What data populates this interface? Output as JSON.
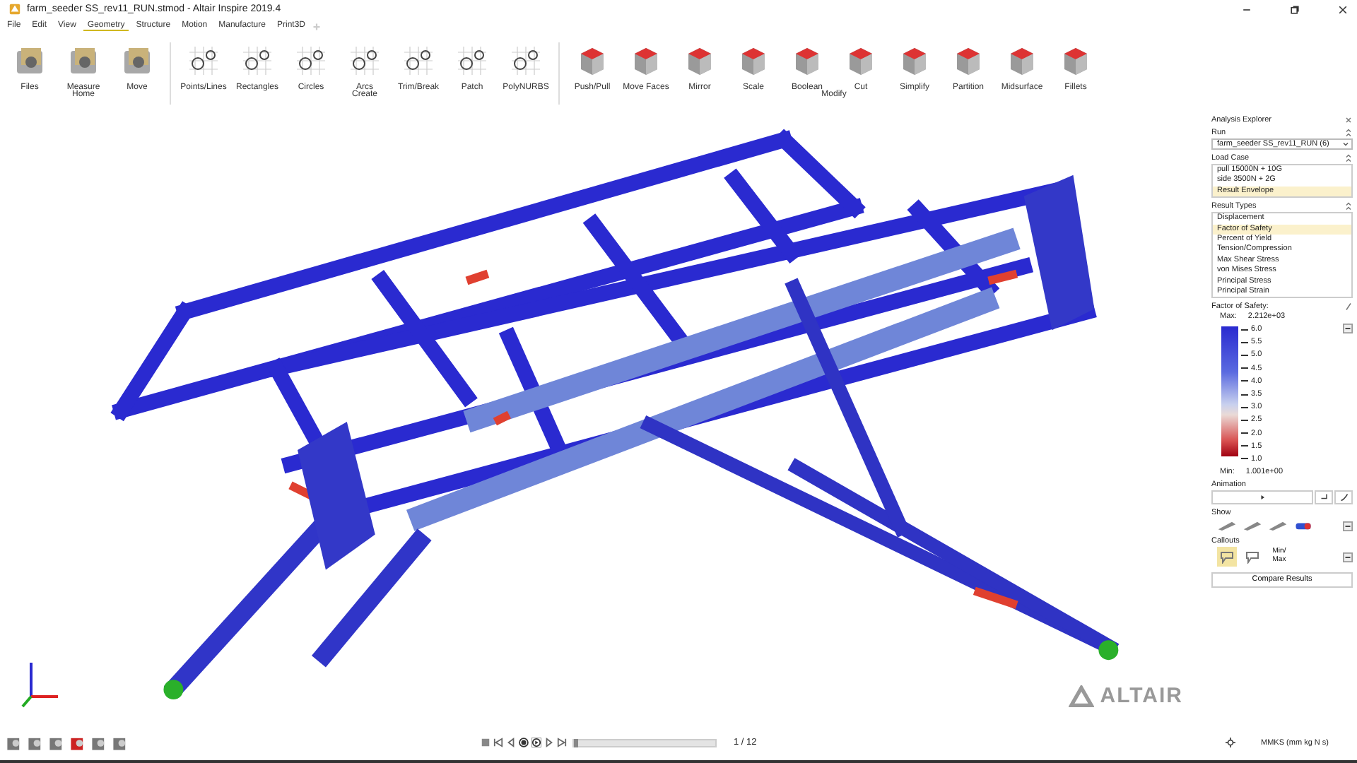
{
  "window": {
    "title": "farm_seeder SS_rev11_RUN.stmod - Altair Inspire 2019.4"
  },
  "menu": [
    {
      "label": "File",
      "selected": false
    },
    {
      "label": "Edit",
      "selected": false
    },
    {
      "label": "View",
      "selected": false
    },
    {
      "label": "Geometry",
      "selected": true
    },
    {
      "label": "Structure",
      "selected": false
    },
    {
      "label": "Motion",
      "selected": false
    },
    {
      "label": "Manufacture",
      "selected": false
    },
    {
      "label": "Print3D",
      "selected": false
    }
  ],
  "ribbon": [
    {
      "label": "Home",
      "tools": [
        "Files",
        "Measure",
        "Move"
      ]
    },
    {
      "label": "Create",
      "tools": [
        "Points/Lines",
        "Rectangles",
        "Circles",
        "Arcs",
        "Trim/Break",
        "Patch",
        "PolyNURBS"
      ]
    },
    {
      "label": "Modify",
      "tools": [
        "Push/Pull",
        "Move Faces",
        "Mirror",
        "Scale",
        "Boolean",
        "Cut",
        "Simplify",
        "Partition",
        "Midsurface",
        "Fillets"
      ]
    }
  ],
  "analysis_explorer": {
    "title": "Analysis Explorer",
    "run_label": "Run",
    "run_value": "farm_seeder SS_rev11_RUN (6)",
    "load_case_label": "Load Case",
    "load_cases": [
      {
        "label": "pull 15000N + 10G",
        "selected": false
      },
      {
        "label": "side 3500N + 2G",
        "selected": false
      },
      {
        "label": "Result Envelope",
        "selected": true
      }
    ],
    "result_types_label": "Result Types",
    "result_types": [
      {
        "label": "Displacement",
        "selected": false
      },
      {
        "label": "Factor of Safety",
        "selected": true
      },
      {
        "label": "Percent of Yield",
        "selected": false
      },
      {
        "label": "Tension/Compression",
        "selected": false
      },
      {
        "label": "Max Shear Stress",
        "selected": false
      },
      {
        "label": "von Mises Stress",
        "selected": false
      },
      {
        "label": "Principal Stress",
        "selected": false
      },
      {
        "label": "Principal Strain",
        "selected": false
      }
    ],
    "legend": {
      "title": "Factor of Safety:",
      "max_label": "Max:",
      "max_value": "2.212e+03",
      "ticks": [
        "6.0",
        "5.5",
        "5.0",
        "4.5",
        "4.0",
        "3.5",
        "3.0",
        "2.5",
        "2.0",
        "1.5",
        "1.0"
      ],
      "min_label": "Min:",
      "min_value": "1.001e+00"
    },
    "animation_label": "Animation",
    "show_label": "Show",
    "callouts_label": "Callouts",
    "callouts": [
      {
        "kind": "icon",
        "selected": true
      },
      {
        "kind": "icon",
        "selected": false
      },
      {
        "kind": "text",
        "label": "Min/ Max",
        "selected": false
      }
    ],
    "compare_button": "Compare Results"
  },
  "logo": "ALTAIR",
  "playback": {
    "level": 0,
    "frame": "1 / 12"
  },
  "status_bar": {
    "units": "MMKS (mm kg N s)"
  }
}
